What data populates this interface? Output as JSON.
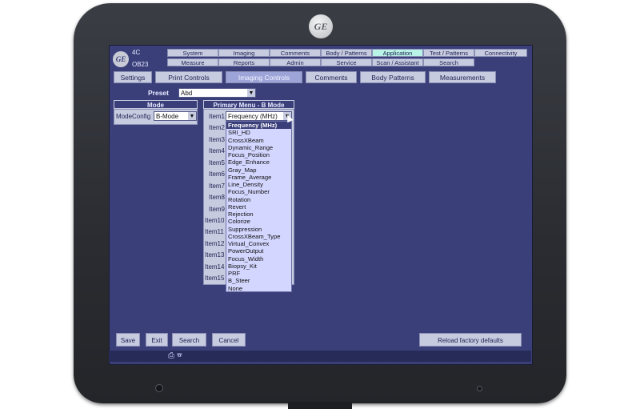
{
  "header": {
    "probe": "4C",
    "exam": "OB23",
    "tabs_row1": [
      "System",
      "Imaging",
      "Comments",
      "Body / Patterns",
      "Application",
      "Test / Patterns",
      "Connectivity"
    ],
    "tabs_row2": [
      "Measure",
      "Reports",
      "Admin",
      "Service",
      "Scan / Assistant",
      "Search"
    ]
  },
  "subtabs": [
    "Settings",
    "Print Controls",
    "Imaging Controls",
    "Comments",
    "Body Patterns",
    "Measurements"
  ],
  "preset": {
    "label": "Preset",
    "value": "Abd"
  },
  "mode_panel": {
    "title": "Mode",
    "label": "ModeConfig",
    "value": "B-Mode"
  },
  "primary_menu": {
    "title": "Primary Menu - B Mode",
    "items": [
      "Item1",
      "Item2",
      "Item3",
      "Item4",
      "Item5",
      "Item6",
      "Item7",
      "Item8",
      "Item9",
      "Item10",
      "Item11",
      "Item12",
      "Item13",
      "Item14",
      "Item15"
    ],
    "item1_value": "Frequency (MHz)"
  },
  "dropdown_options": [
    "Frequency (MHz)",
    "SRI_HD",
    "CrossXBeam",
    "Dynamic_Range",
    "Focus_Position",
    "Edge_Enhance",
    "Gray_Map",
    "Frame_Average",
    "Line_Density",
    "Focus_Number",
    "Rotation",
    "Revert",
    "Rejection",
    "Colorize",
    "Suppression",
    "CrossXBeam_Type",
    "Virtual_Convex",
    "PowerOutput",
    "Focus_Width",
    "Biopsy_Kit",
    "PRF",
    "B_Steer",
    "None"
  ],
  "buttons": {
    "save": "Save",
    "exit": "Exit",
    "search": "Search",
    "cancel": "Cancel",
    "reload": "Reload factory defaults"
  },
  "colors": {
    "screen": "#3a3f7a",
    "button": "#c7cbe0",
    "active_tab": "#b9f2e6",
    "dropdown": "#d3d6ff"
  }
}
